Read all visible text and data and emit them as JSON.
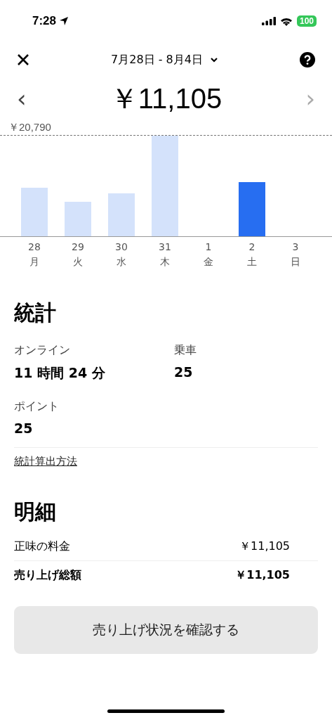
{
  "status_bar": {
    "time": "7:28",
    "battery": "100"
  },
  "header": {
    "date_range": "7月28日 - 8月4日",
    "amount": "￥11,105",
    "prev": "‹",
    "next": "›"
  },
  "chart": {
    "max_label": "￥20,790",
    "days": [
      {
        "date": "28",
        "weekday": "月"
      },
      {
        "date": "29",
        "weekday": "火"
      },
      {
        "date": "30",
        "weekday": "水"
      },
      {
        "date": "31",
        "weekday": "木"
      },
      {
        "date": "1",
        "weekday": "金"
      },
      {
        "date": "2",
        "weekday": "土"
      },
      {
        "date": "3",
        "weekday": "日"
      }
    ]
  },
  "stats": {
    "title": "統計",
    "items": [
      {
        "label": "オンライン",
        "value": "11 時間 24 分"
      },
      {
        "label": "乗車",
        "value": "25"
      },
      {
        "label": "ポイント",
        "value": "25"
      }
    ],
    "link": "統計算出方法"
  },
  "details": {
    "title": "明細",
    "rows": [
      {
        "label": "正味の料金",
        "value": "￥11,105",
        "bold": false
      },
      {
        "label": "売り上げ総額",
        "value": "￥11,105",
        "bold": true
      }
    ]
  },
  "button": "売り上げ状況を確認する"
}
